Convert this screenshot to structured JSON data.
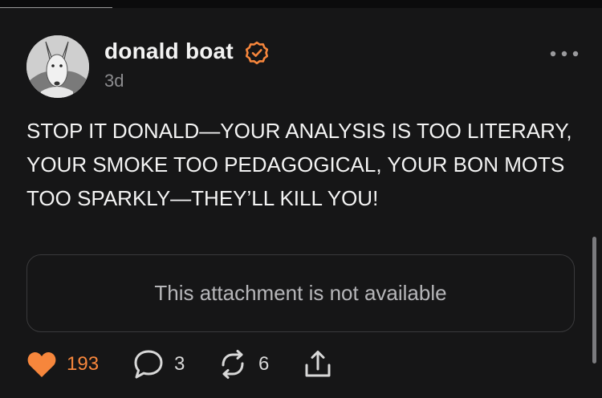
{
  "post": {
    "author": "donald boat",
    "time": "3d",
    "text": "STOP IT DONALD—YOUR ANALYSIS IS TOO LITERARY, YOUR SMOKE TOO PEDAGOGICAL, YOUR BON MOTS TOO SPARKLY—THEY’LL KILL YOU!",
    "attachment_notice": "This attachment is not available"
  },
  "actions": {
    "likes": "193",
    "replies": "3",
    "reposts": "6"
  },
  "colors": {
    "background": "#161617",
    "accent": "#f6863c",
    "muted": "#8c8c8f"
  },
  "icons": [
    "verified-icon",
    "more-icon",
    "heart-icon",
    "comment-icon",
    "repost-icon",
    "share-icon"
  ]
}
